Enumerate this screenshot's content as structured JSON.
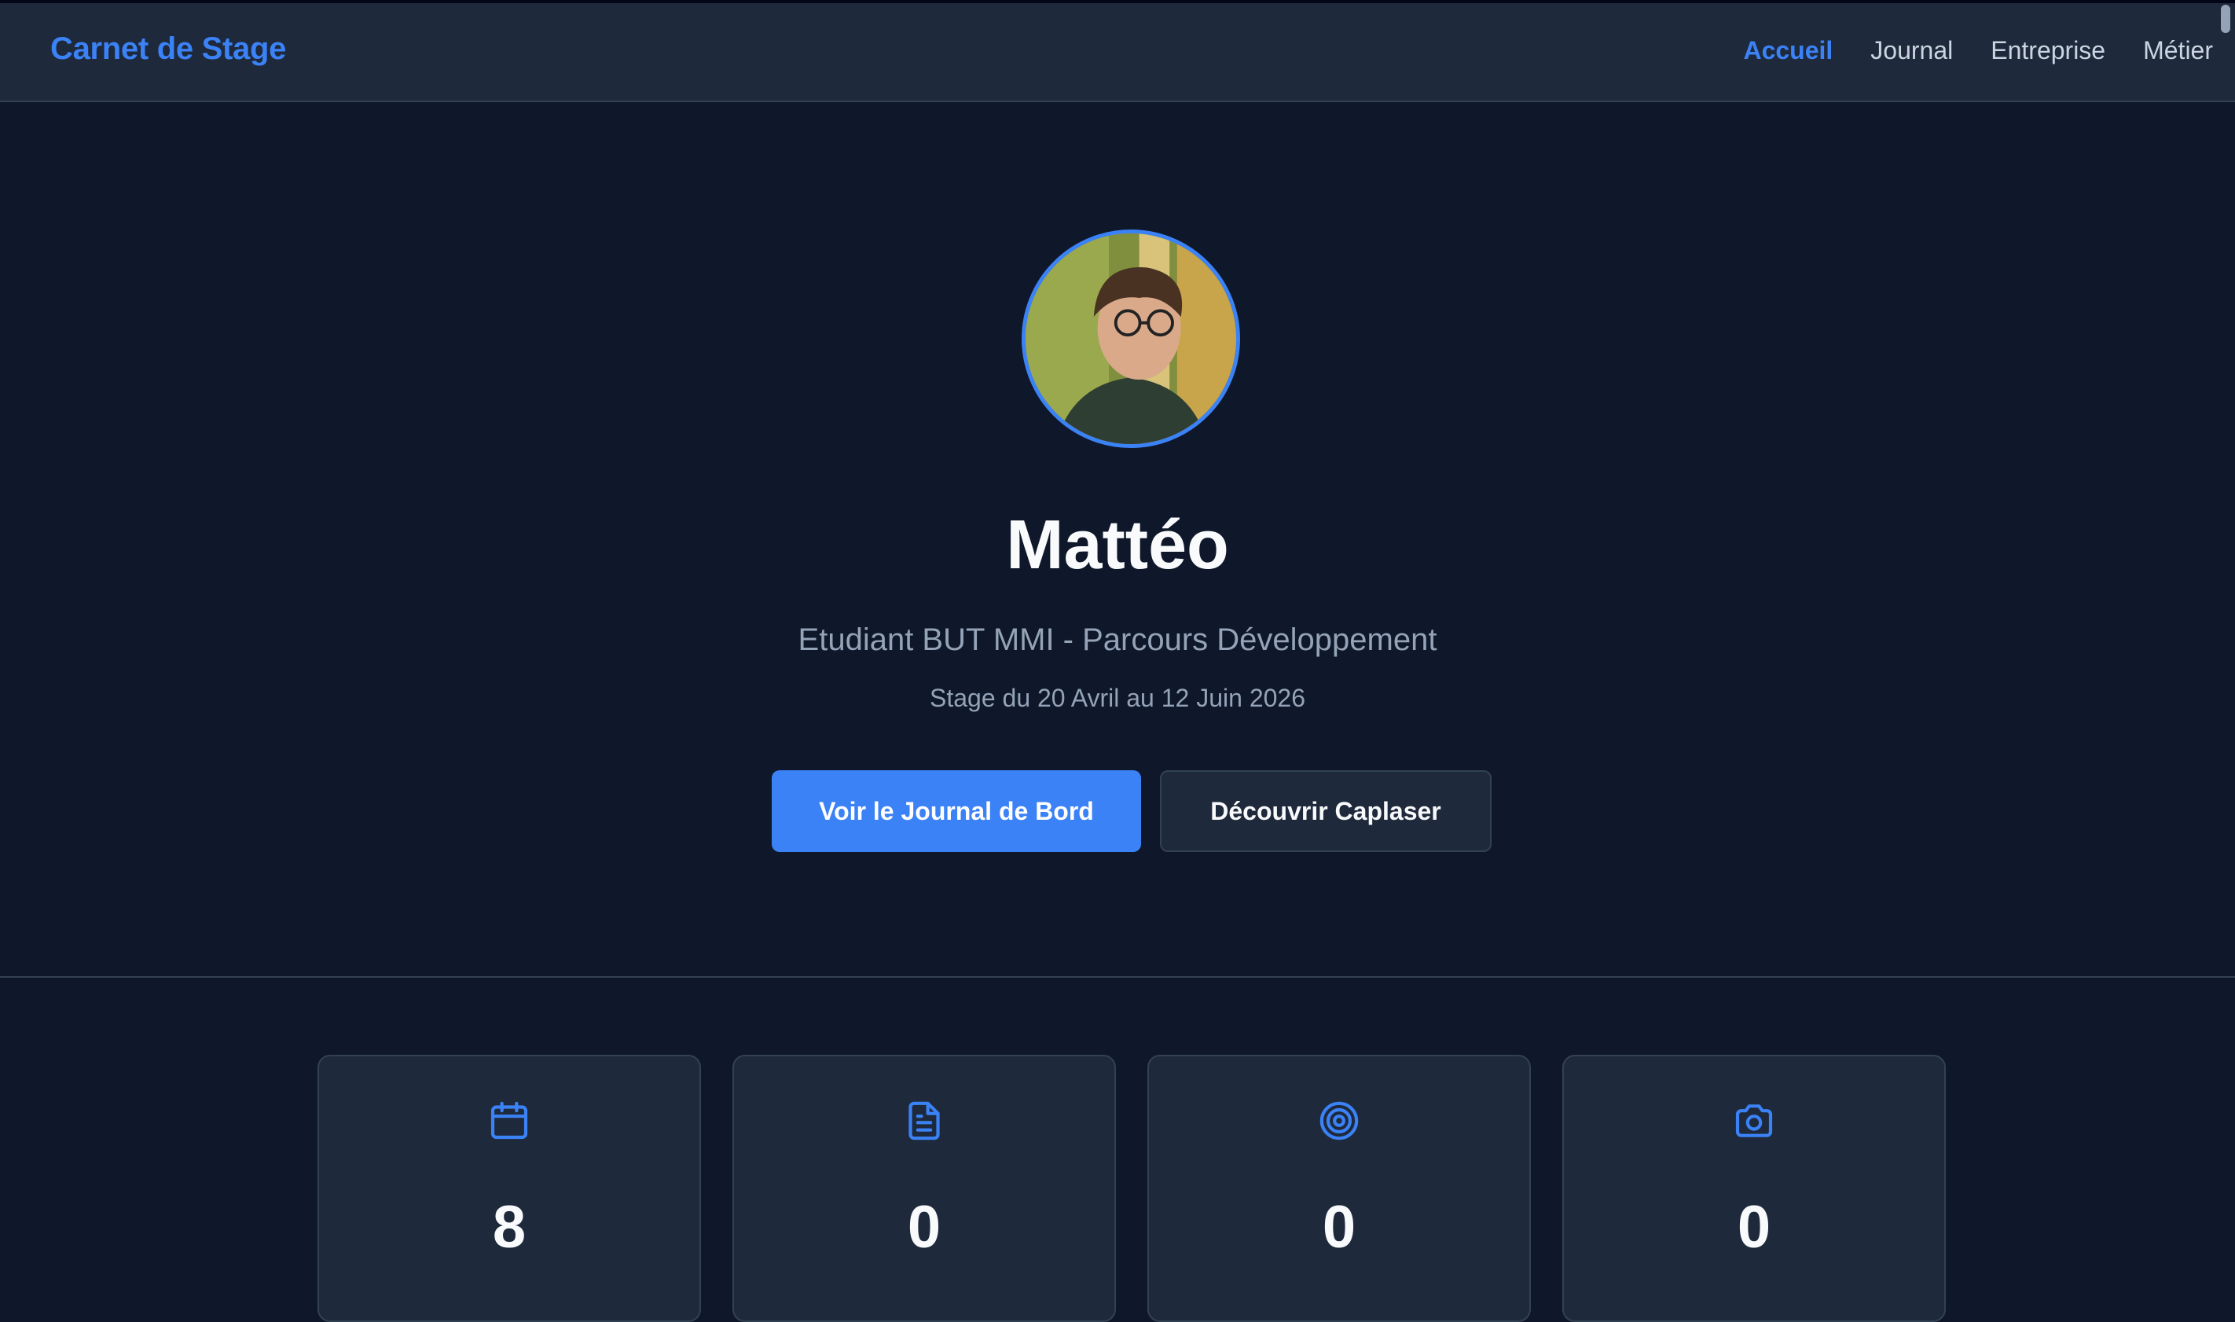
{
  "nav": {
    "brand": "Carnet de Stage",
    "links": [
      {
        "label": "Accueil",
        "active": true
      },
      {
        "label": "Journal",
        "active": false
      },
      {
        "label": "Entreprise",
        "active": false
      },
      {
        "label": "Métier",
        "active": false
      }
    ]
  },
  "hero": {
    "name": "Mattéo",
    "subtitle": "Etudiant BUT MMI - Parcours Développement",
    "dates": "Stage du 20 Avril au 12 Juin 2026",
    "primary_button": "Voir le Journal de Bord",
    "secondary_button": "Découvrir Caplaser"
  },
  "stats": [
    {
      "icon": "calendar-icon",
      "value": "8"
    },
    {
      "icon": "document-icon",
      "value": "0"
    },
    {
      "icon": "target-icon",
      "value": "0"
    },
    {
      "icon": "camera-icon",
      "value": "0"
    }
  ],
  "colors": {
    "accent": "#3b82f6",
    "background": "#0f172a",
    "surface": "#1e293b",
    "border": "#334155",
    "muted_text": "#94a3b8"
  }
}
